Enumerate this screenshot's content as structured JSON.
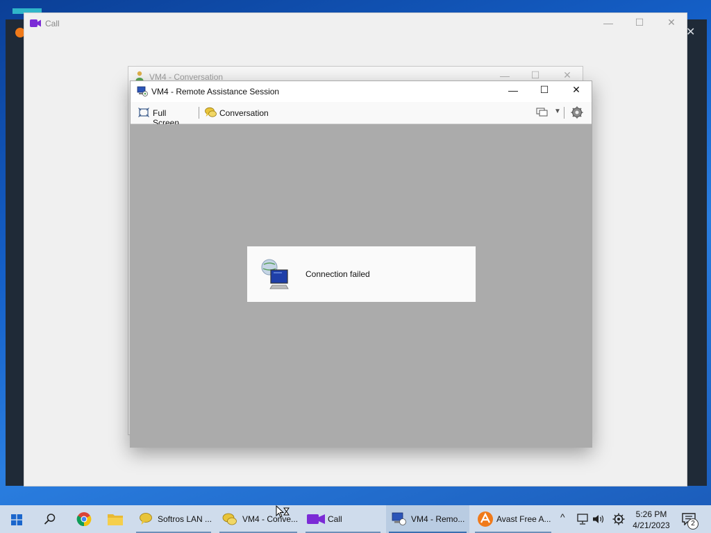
{
  "background_window": {
    "close_glyph": "✕"
  },
  "call_window": {
    "title": "Call",
    "icon": "video-camera-icon",
    "controls": {
      "minimize": "—",
      "maximize": "☐",
      "close": "✕"
    }
  },
  "conversation_window": {
    "title": "VM4 - Conversation",
    "icon": "user-icon"
  },
  "ra_window": {
    "title": "VM4 - Remote Assistance Session",
    "icon": "remote-assistance-icon",
    "controls": {
      "minimize": "—",
      "maximize": "☐",
      "close": "✕"
    },
    "toolbar": {
      "full_screen": "Full Screen",
      "conversation": "Conversation"
    },
    "message": {
      "text": "Connection failed"
    }
  },
  "taskbar": {
    "items": [
      {
        "label": "Softros LAN ..."
      },
      {
        "label": "VM4 - Conve..."
      },
      {
        "label": "Call"
      },
      {
        "label": "VM4 - Remo..."
      },
      {
        "label": "Avast Free A..."
      }
    ],
    "clock": {
      "time": "5:26 PM",
      "date": "4/21/2023"
    },
    "notification_count": "2"
  },
  "colors": {
    "taskbar": "#cfdcec",
    "desktop": "#1560c8",
    "avast": "#f07a1a",
    "call_icon": "#7b2bd6"
  }
}
